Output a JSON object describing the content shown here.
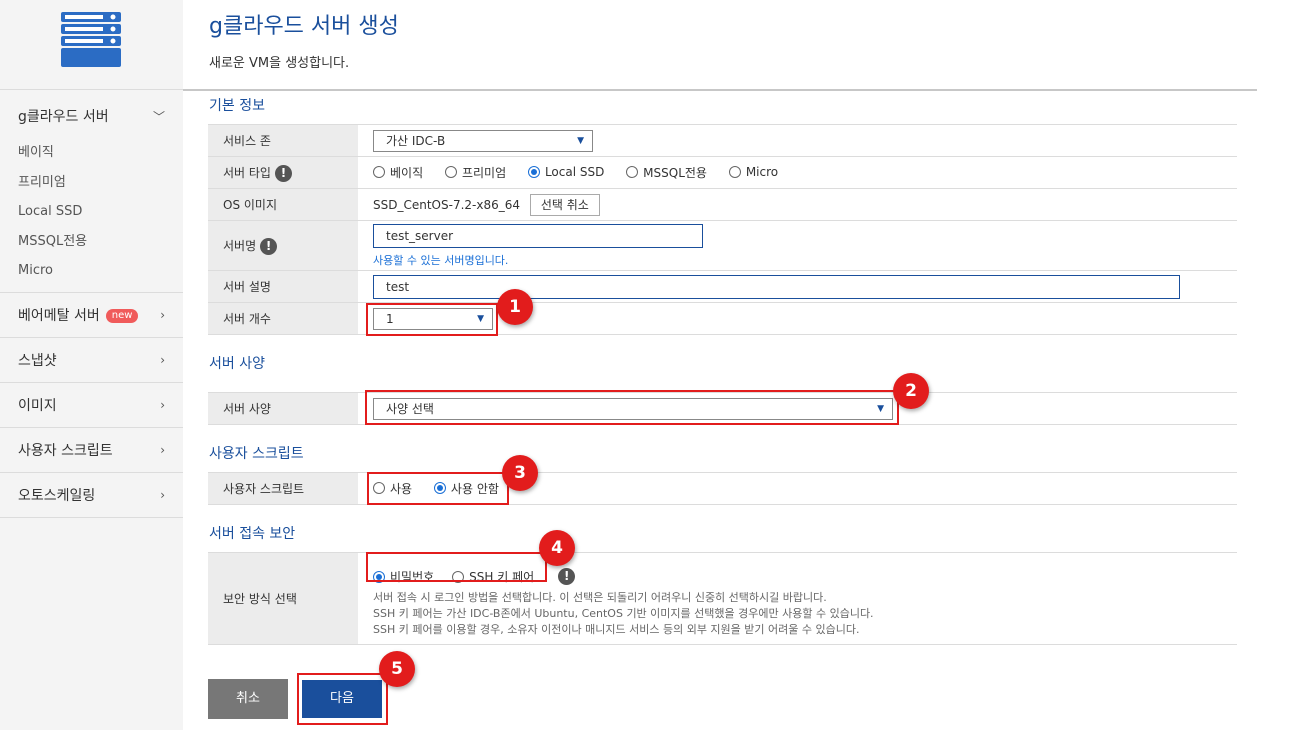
{
  "sidebar": {
    "groups": [
      {
        "label": "g클라우드 서버",
        "chevron": "﹀",
        "items": [
          "베이직",
          "프리미엄",
          "Local SSD",
          "MSSQL전용",
          "Micro"
        ]
      },
      {
        "label": "베어메탈 서버",
        "badge": "new",
        "chevron": "›"
      },
      {
        "label": "스냅샷",
        "chevron": "›"
      },
      {
        "label": "이미지",
        "chevron": "›"
      },
      {
        "label": "사용자 스크립트",
        "chevron": "›"
      },
      {
        "label": "오토스케일링",
        "chevron": "›"
      }
    ]
  },
  "header": {
    "title": "g클라우드 서버 생성",
    "subtitle": "새로운 VM을 생성합니다."
  },
  "basic": {
    "title": "기본 정보",
    "zone_label": "서비스 존",
    "zone_value": "가산 IDC-B",
    "type_label": "서버 타입",
    "type_options": [
      "베이직",
      "프리미엄",
      "Local SSD",
      "MSSQL전용",
      "Micro"
    ],
    "type_selected": 2,
    "os_label": "OS 이미지",
    "os_value": "SSD_CentOS-7.2-x86_64",
    "os_cancel": "선택 취소",
    "name_label": "서버명",
    "name_value": "test_server",
    "name_hint": "사용할 수 있는 서버명입니다.",
    "desc_label": "서버 설명",
    "desc_value": "test",
    "count_label": "서버 개수",
    "count_value": "1"
  },
  "spec": {
    "title": "서버 사양",
    "label": "서버 사양",
    "value": "사양 선택"
  },
  "script": {
    "title": "사용자 스크립트",
    "label": "사용자 스크립트",
    "options": [
      "사용",
      "사용 안함"
    ],
    "selected": 1
  },
  "security": {
    "title": "서버 접속 보안",
    "label": "보안 방식 선택",
    "options": [
      "비밀번호",
      "SSH 키 페어"
    ],
    "selected": 0,
    "notes": [
      "서버 접속 시 로그인 방법을 선택합니다. 이 선택은 되돌리기 어려우니 신중히 선택하시길 바랍니다.",
      "SSH 키 페어는 가산 IDC-B존에서 Ubuntu, CentOS 기반 이미지를 선택했을 경우에만 사용할 수 있습니다.",
      "SSH 키 페어를 이용할 경우, 소유자 이전이나 매니지드 서비스 등의 외부 지원을 받기 어려울 수 있습니다."
    ]
  },
  "buttons": {
    "cancel": "취소",
    "next": "다음"
  },
  "markers": [
    "1",
    "2",
    "3",
    "4",
    "5"
  ],
  "icons": {
    "logo": "server-stack-icon",
    "info": "exclamation-icon",
    "caret": "chevron-down-icon"
  },
  "colors": {
    "accent": "#1a4f9c",
    "annotation": "#e21c1c",
    "badge": "#f05b5b"
  }
}
